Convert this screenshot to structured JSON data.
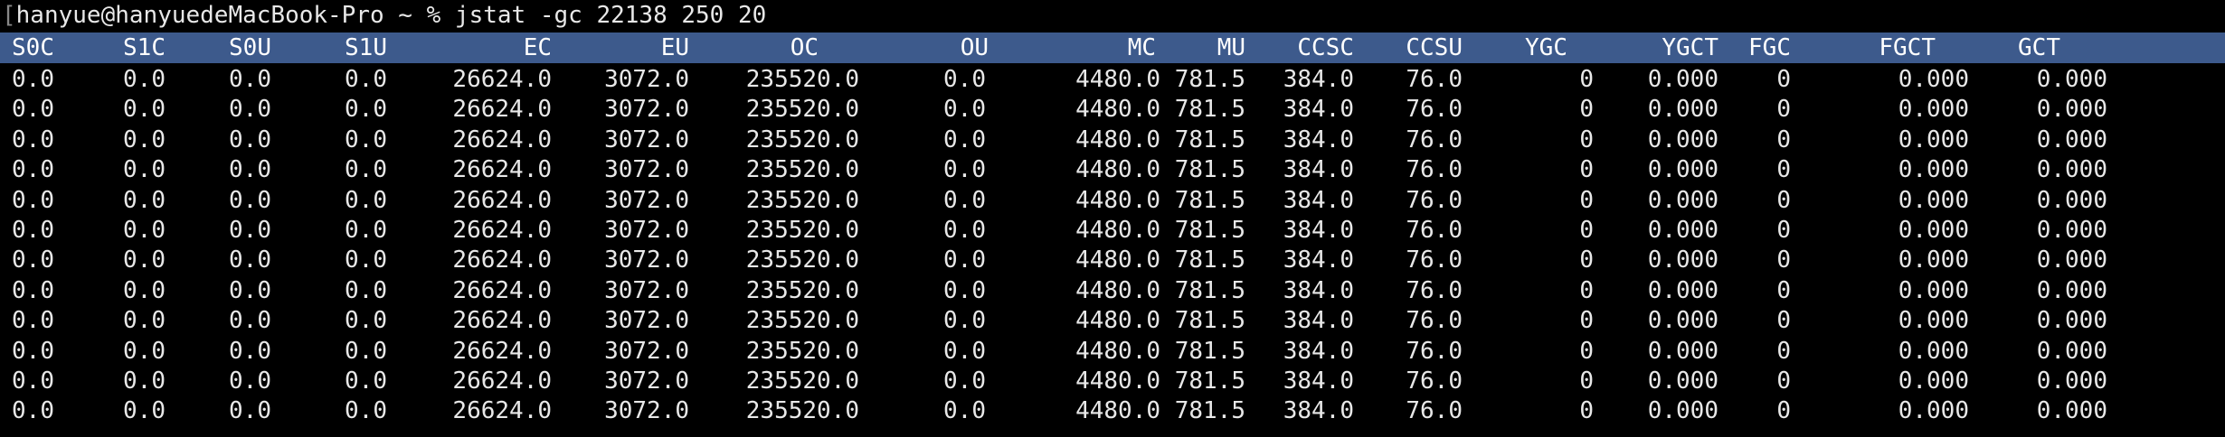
{
  "terminal": {
    "prompt_bracket": "[",
    "prompt": "hanyue@hanyuedeMacBook-Pro ~ % ",
    "command": "jstat -gc 22138 250 20"
  },
  "columns": [
    "S0C",
    "S1C",
    "S0U",
    "S1U",
    "EC",
    "EU",
    "OC",
    "OU",
    "MC",
    "MU",
    "CCSC",
    "CCSU",
    "YGC",
    "YGCT",
    "FGC",
    "FGCT",
    "GCT"
  ],
  "rows": [
    [
      "0.0",
      "0.0",
      "0.0",
      "0.0",
      "26624.0",
      "3072.0",
      "235520.0",
      "0.0",
      "4480.0",
      "781.5",
      "384.0",
      "76.0",
      "0",
      "0.000",
      "0",
      "0.000",
      "0.000"
    ],
    [
      "0.0",
      "0.0",
      "0.0",
      "0.0",
      "26624.0",
      "3072.0",
      "235520.0",
      "0.0",
      "4480.0",
      "781.5",
      "384.0",
      "76.0",
      "0",
      "0.000",
      "0",
      "0.000",
      "0.000"
    ],
    [
      "0.0",
      "0.0",
      "0.0",
      "0.0",
      "26624.0",
      "3072.0",
      "235520.0",
      "0.0",
      "4480.0",
      "781.5",
      "384.0",
      "76.0",
      "0",
      "0.000",
      "0",
      "0.000",
      "0.000"
    ],
    [
      "0.0",
      "0.0",
      "0.0",
      "0.0",
      "26624.0",
      "3072.0",
      "235520.0",
      "0.0",
      "4480.0",
      "781.5",
      "384.0",
      "76.0",
      "0",
      "0.000",
      "0",
      "0.000",
      "0.000"
    ],
    [
      "0.0",
      "0.0",
      "0.0",
      "0.0",
      "26624.0",
      "3072.0",
      "235520.0",
      "0.0",
      "4480.0",
      "781.5",
      "384.0",
      "76.0",
      "0",
      "0.000",
      "0",
      "0.000",
      "0.000"
    ],
    [
      "0.0",
      "0.0",
      "0.0",
      "0.0",
      "26624.0",
      "3072.0",
      "235520.0",
      "0.0",
      "4480.0",
      "781.5",
      "384.0",
      "76.0",
      "0",
      "0.000",
      "0",
      "0.000",
      "0.000"
    ],
    [
      "0.0",
      "0.0",
      "0.0",
      "0.0",
      "26624.0",
      "3072.0",
      "235520.0",
      "0.0",
      "4480.0",
      "781.5",
      "384.0",
      "76.0",
      "0",
      "0.000",
      "0",
      "0.000",
      "0.000"
    ],
    [
      "0.0",
      "0.0",
      "0.0",
      "0.0",
      "26624.0",
      "3072.0",
      "235520.0",
      "0.0",
      "4480.0",
      "781.5",
      "384.0",
      "76.0",
      "0",
      "0.000",
      "0",
      "0.000",
      "0.000"
    ],
    [
      "0.0",
      "0.0",
      "0.0",
      "0.0",
      "26624.0",
      "3072.0",
      "235520.0",
      "0.0",
      "4480.0",
      "781.5",
      "384.0",
      "76.0",
      "0",
      "0.000",
      "0",
      "0.000",
      "0.000"
    ],
    [
      "0.0",
      "0.0",
      "0.0",
      "0.0",
      "26624.0",
      "3072.0",
      "235520.0",
      "0.0",
      "4480.0",
      "781.5",
      "384.0",
      "76.0",
      "0",
      "0.000",
      "0",
      "0.000",
      "0.000"
    ],
    [
      "0.0",
      "0.0",
      "0.0",
      "0.0",
      "26624.0",
      "3072.0",
      "235520.0",
      "0.0",
      "4480.0",
      "781.5",
      "384.0",
      "76.0",
      "0",
      "0.000",
      "0",
      "0.000",
      "0.000"
    ],
    [
      "0.0",
      "0.0",
      "0.0",
      "0.0",
      "26624.0",
      "3072.0",
      "235520.0",
      "0.0",
      "4480.0",
      "781.5",
      "384.0",
      "76.0",
      "0",
      "0.000",
      "0",
      "0.000",
      "0.000"
    ]
  ],
  "colors": {
    "background": "#000000",
    "header_band": "#3d5a8c",
    "text": "#e8e8e8"
  }
}
